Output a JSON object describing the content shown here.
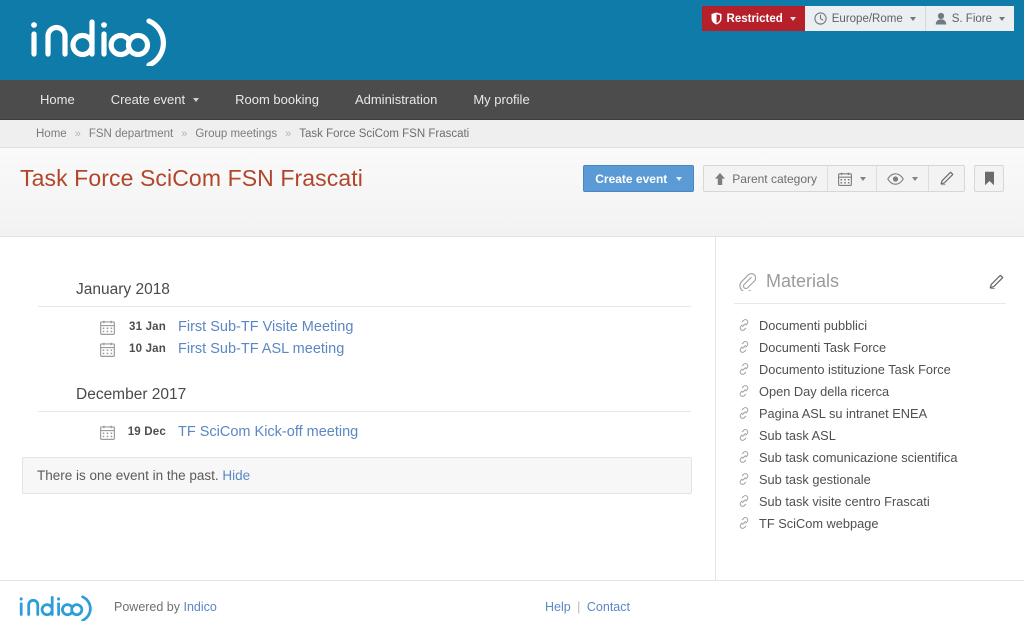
{
  "brand": {
    "logo_text": "indico",
    "header_bg": "#0f7ba8",
    "accent_blue": "#5b9bd5",
    "link_blue": "#5b87c4",
    "title_color": "#b1462b",
    "restricted_red": "#b5202b"
  },
  "topbar": {
    "protection": {
      "label": "Restricted",
      "icon": "shield-icon"
    },
    "timezone": {
      "label": "Europe/Rome",
      "icon": "clock-icon"
    },
    "user": {
      "label": "S. Fiore",
      "icon": "user-icon"
    }
  },
  "nav": {
    "items": [
      {
        "label": "Home",
        "has_caret": false
      },
      {
        "label": "Create event",
        "has_caret": true
      },
      {
        "label": "Room booking",
        "has_caret": false
      },
      {
        "label": "Administration",
        "has_caret": false
      },
      {
        "label": "My profile",
        "has_caret": false
      }
    ]
  },
  "breadcrumb": {
    "separator": "»",
    "items": [
      "Home",
      "FSN department",
      "Group meetings",
      "Task Force SciCom FSN Frascati"
    ]
  },
  "page": {
    "title": "Task Force SciCom FSN Frascati"
  },
  "actions": {
    "create_event": {
      "label": "Create event",
      "icon": "chevron-down-icon"
    },
    "parent_category": {
      "label": "Parent category",
      "icon": "arrow-up-icon"
    },
    "calendar": {
      "icon": "calendar-icon",
      "has_caret": true
    },
    "visibility": {
      "icon": "eye-icon",
      "has_caret": true
    },
    "edit": {
      "icon": "pencil-icon"
    },
    "bookmark": {
      "icon": "bookmark-icon"
    }
  },
  "events": {
    "months": [
      {
        "label": "January 2018",
        "items": [
          {
            "date": "31 Jan",
            "title": "First Sub-TF Visite Meeting",
            "icon": "calendar-icon"
          },
          {
            "date": "10 Jan",
            "title": "First Sub-TF ASL meeting",
            "icon": "calendar-icon"
          }
        ]
      },
      {
        "label": "December 2017",
        "items": [
          {
            "date": "19 Dec",
            "title": "TF SciCom Kick-off meeting",
            "icon": "calendar-icon"
          }
        ]
      }
    ],
    "past_note": {
      "text": "There is one event in the past.",
      "action": "Hide"
    }
  },
  "materials": {
    "title": "Materials",
    "header_icon": "paperclip-icon",
    "edit_icon": "pencil-icon",
    "items": [
      "Documenti pubblici",
      "Documenti Task Force",
      "Documento istituzione Task Force",
      "Open Day della ricerca",
      "Pagina ASL su intranet ENEA",
      "Sub task ASL",
      "Sub task comunicazione scientifica",
      "Sub task gestionale",
      "Sub task visite centro Frascati",
      "TF SciCom webpage"
    ]
  },
  "footer": {
    "powered_prefix": "Powered by ",
    "powered_link": "Indico",
    "help": "Help",
    "separator": "|",
    "contact": "Contact"
  }
}
